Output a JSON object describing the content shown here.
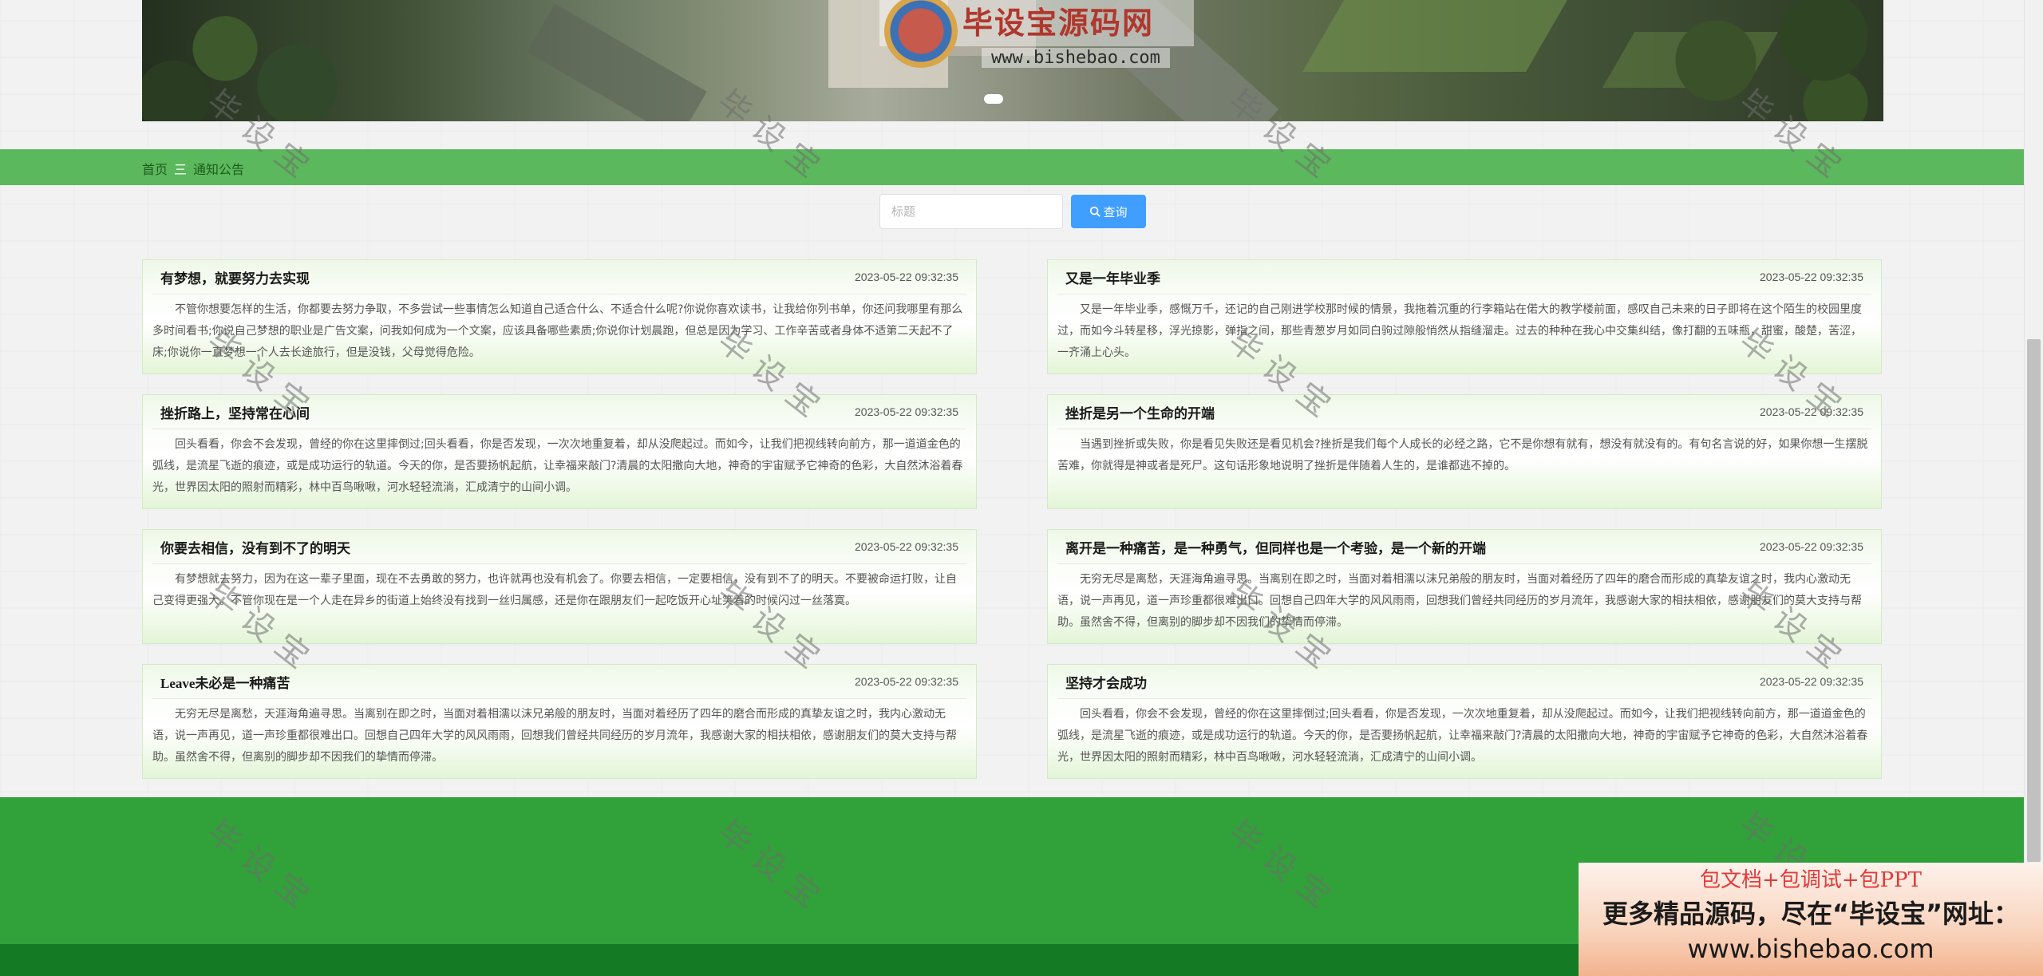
{
  "banner": {
    "logo_title": "毕设宝源码网",
    "logo_seal_text": "毕设宝",
    "logo_url": "www.bishebao.com"
  },
  "breadcrumb": {
    "home": "首页",
    "separator": "三",
    "current": "通知公告"
  },
  "search": {
    "placeholder": "标题",
    "button_label": "查询"
  },
  "notices": [
    {
      "title": "有梦想，就要努力去实现",
      "time": "2023-05-22 09:32:35",
      "content": "不管你想要怎样的生活，你都要去努力争取，不多尝试一些事情怎么知道自己适合什么、不适合什么呢?你说你喜欢读书，让我给你列书单，你还问我哪里有那么多时间看书;你说自己梦想的职业是广告文案，问我如何成为一个文案，应该具备哪些素质;你说你计划晨跑，但总是因为学习、工作辛苦或者身体不适第二天起不了床;你说你一直梦想一个人去长途旅行，但是没钱，父母觉得危险。"
    },
    {
      "title": "又是一年毕业季",
      "time": "2023-05-22 09:32:35",
      "content": "又是一年毕业季，感慨万千，还记的自己刚进学校那时候的情景，我拖着沉重的行李箱站在偌大的教学楼前面，感叹自己未来的日子即将在这个陌生的校园里度过，而如今斗转星移，浮光掠影，弹指之间，那些青葱岁月如同白驹过隙般悄然从指缝溜走。过去的种种在我心中交集纠结，像打翻的五味瓶，甜蜜，酸楚，苦涩，一齐涌上心头。"
    },
    {
      "title": "挫折路上，坚持常在心间",
      "time": "2023-05-22 09:32:35",
      "content": "回头看看，你会不会发现，曾经的你在这里摔倒过;回头看看，你是否发现，一次次地重复着，却从没爬起过。而如今，让我们把视线转向前方，那一道道金色的弧线，是流星飞逝的痕迹，或是成功运行的轨道。今天的你，是否要扬帆起航，让幸福来敲门?清晨的太阳撒向大地，神奇的宇宙赋予它神奇的色彩，大自然沐浴着春光，世界因太阳的照射而精彩，林中百鸟啾啾，河水轻轻流淌，汇成清宁的山间小调。"
    },
    {
      "title": "挫折是另一个生命的开端",
      "time": "2023-05-22 09:32:35",
      "content": "当遇到挫折或失败，你是看见失败还是看见机会?挫折是我们每个人成长的必经之路，它不是你想有就有，想没有就没有的。有句名言说的好，如果你想一生摆脱苦难，你就得是神或者是死尸。这句话形象地说明了挫折是伴随着人生的，是谁都逃不掉的。"
    },
    {
      "title": "你要去相信，没有到不了的明天",
      "time": "2023-05-22 09:32:35",
      "content": "有梦想就去努力，因为在这一辈子里面，现在不去勇敢的努力，也许就再也没有机会了。你要去相信，一定要相信，没有到不了的明天。不要被命运打败，让自己变得更强大。不管你现在是一个人走在异乡的街道上始终没有找到一丝归属感，还是你在跟朋友们一起吃饭开心址笑着的时候闪过一丝落寞。"
    },
    {
      "title": "离开是一种痛苦，是一种勇气，但同样也是一个考验，是一个新的开端",
      "time": "2023-05-22 09:32:35",
      "content": "无穷无尽是离愁，天涯海角遍寻思。当离别在即之时，当面对着相濡以沫兄弟般的朋友时，当面对着经历了四年的磨合而形成的真挚友谊之时，我内心激动无语，说一声再见，道一声珍重都很难出口。回想自己四年大学的风风雨雨，回想我们曾经共同经历的岁月流年，我感谢大家的相扶相依，感谢朋友们的莫大支持与帮助。虽然舍不得，但离别的脚步却不因我们的挚情而停滞。"
    },
    {
      "title": "Leave未必是一种痛苦",
      "time": "2023-05-22 09:32:35",
      "content": "无穷无尽是离愁，天涯海角遍寻思。当离别在即之时，当面对着相濡以沫兄弟般的朋友时，当面对着经历了四年的磨合而形成的真挚友谊之时，我内心激动无语，说一声再见，道一声珍重都很难出口。回想自己四年大学的风风雨雨，回想我们曾经共同经历的岁月流年，我感谢大家的相扶相依，感谢朋友们的莫大支持与帮助。虽然舍不得，但离别的脚步却不因我们的挚情而停滞。"
    },
    {
      "title": "坚持才会成功",
      "time": "2023-05-22 09:32:35",
      "content": "回头看看，你会不会发现，曾经的你在这里摔倒过;回头看看，你是否发现，一次次地重复着，却从没爬起过。而如今，让我们把视线转向前方，那一道道金色的弧线，是流星飞逝的痕迹，或是成功运行的轨道。今天的你，是否要扬帆起航，让幸福来敲门?清晨的太阳撒向大地，神奇的宇宙赋予它神奇的色彩，大自然沐浴着春光，世界因太阳的照射而精彩，林中百鸟啾啾，河水轻轻流淌，汇成清宁的山间小调。"
    }
  ],
  "watermark": "毕设宝",
  "ad": {
    "line1": "包文档+包调试+包PPT",
    "line2": "更多精品源码，尽在“毕设宝”网址：",
    "line3": "www.bishebao.com"
  },
  "colors": {
    "breadcrumb_bar": "#5cb85c",
    "search_button": "#409eff",
    "footer": "#31a13a",
    "footer_strip": "#157a24"
  }
}
